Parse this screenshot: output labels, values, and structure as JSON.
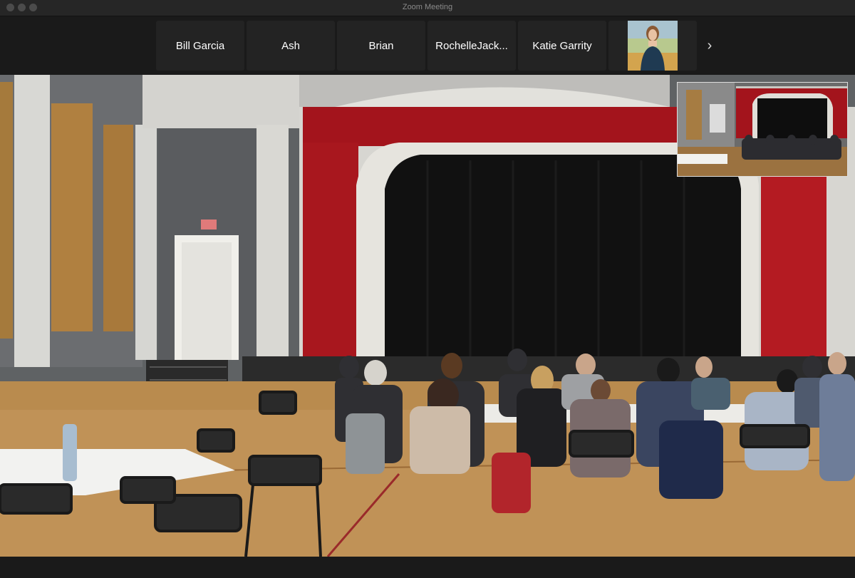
{
  "window": {
    "title": "Zoom Meeting"
  },
  "participants": [
    {
      "name": "Bill Garcia"
    },
    {
      "name": "Ash"
    },
    {
      "name": "Brian"
    },
    {
      "name": "RochelleJack..."
    },
    {
      "name": "Katie Garrity"
    }
  ],
  "gallery": {
    "next_icon": "chevron-right-icon"
  }
}
